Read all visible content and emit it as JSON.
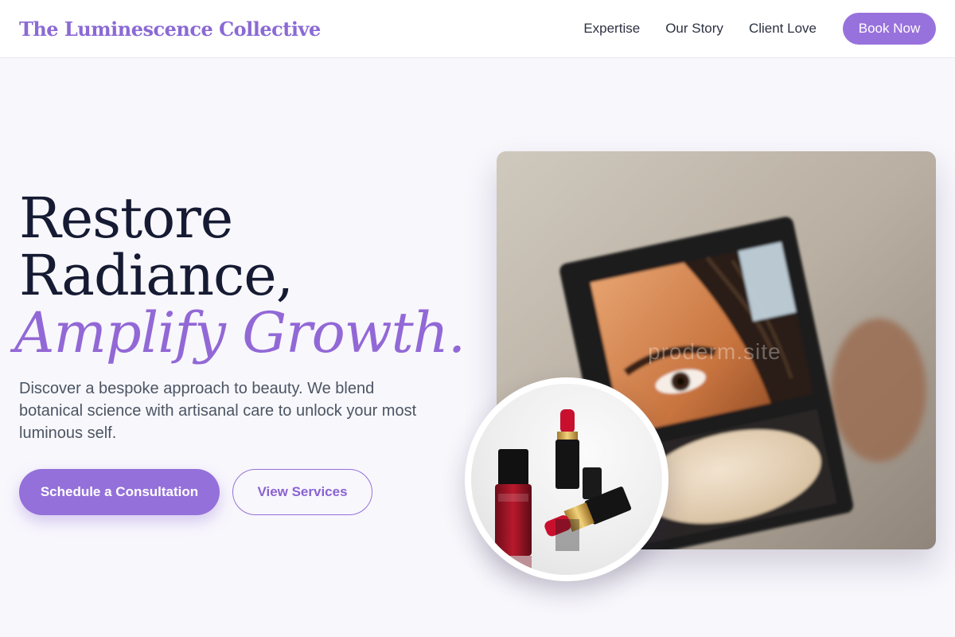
{
  "header": {
    "brand": "The Luminescence Collective",
    "nav": [
      "Expertise",
      "Our Story",
      "Client Love"
    ],
    "cta": "Book Now"
  },
  "hero": {
    "title_line1": "Restore",
    "title_line2": "Radiance,",
    "title_accent": "Amplify Growth.",
    "description": "Discover a bespoke approach to beauty. We blend botanical science with artisanal care to unlock your most luminous self.",
    "primary_button": "Schedule a Consultation",
    "secondary_button": "View Services"
  },
  "images": {
    "main_watermark": "proderm.site"
  },
  "colors": {
    "brand": "#8b6ad4",
    "accent": "#9470da",
    "background": "#f8f7fc",
    "heading": "#161b33"
  }
}
